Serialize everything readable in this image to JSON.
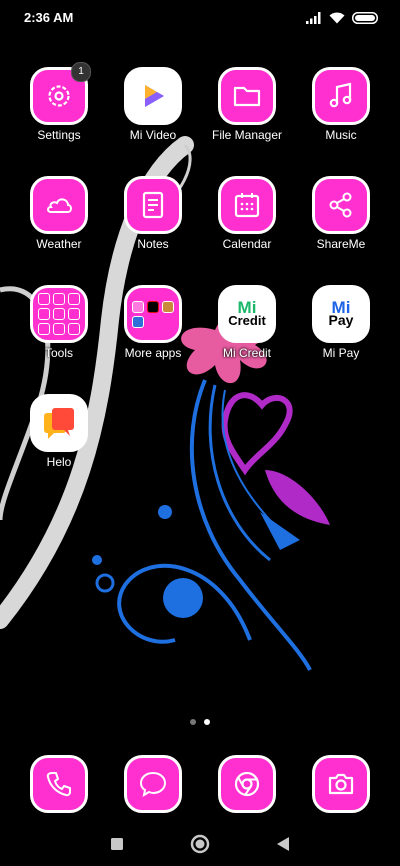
{
  "status_bar": {
    "time": "2:36 AM",
    "icons": [
      "signal-icon",
      "wifi-icon",
      "battery-icon"
    ]
  },
  "apps": [
    {
      "label": "Settings",
      "icon": "gear-icon",
      "badge": "1"
    },
    {
      "label": "Mi Video",
      "icon": "play-icon"
    },
    {
      "label": "File Manager",
      "icon": "folder-icon"
    },
    {
      "label": "Music",
      "icon": "music-note-icon"
    },
    {
      "label": "Weather",
      "icon": "cloud-icon"
    },
    {
      "label": "Notes",
      "icon": "note-icon"
    },
    {
      "label": "Calendar",
      "icon": "calendar-icon"
    },
    {
      "label": "ShareMe",
      "icon": "share-icon"
    },
    {
      "label": "Tools",
      "icon": "folder-icon"
    },
    {
      "label": "More apps",
      "icon": "folder-icon"
    },
    {
      "label": "Mi Credit",
      "icon": "mi-credit-logo",
      "logo_main": "Mi",
      "logo_sub": "Credit"
    },
    {
      "label": "Mi Pay",
      "icon": "mi-pay-logo",
      "logo_main": "Mi",
      "logo_sub": "Pay"
    },
    {
      "label": "Helo",
      "icon": "chat-bubbles-icon"
    }
  ],
  "dock": [
    {
      "icon": "phone-icon"
    },
    {
      "icon": "message-icon"
    },
    {
      "icon": "browser-icon"
    },
    {
      "icon": "camera-icon"
    }
  ],
  "page_indicator": {
    "pages": 2,
    "current": 2
  },
  "nav_bar": [
    "recents-button",
    "home-button",
    "back-button"
  ],
  "colors": {
    "icon_bg": "#ff2fd0",
    "icon_border": "#ffffff"
  }
}
